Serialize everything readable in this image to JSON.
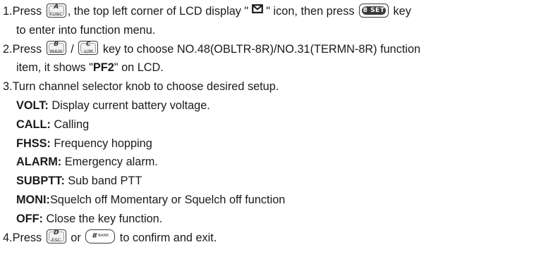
{
  "lines": {
    "l1": {
      "t1": "1.Press ",
      "t2": ", the top left corner of LCD display \" ",
      "t3": " \" icon, then press ",
      "t4": " key"
    },
    "l2": {
      "t1": "to enter into function menu."
    },
    "l3": {
      "t1": "2.Press ",
      "t2": " / ",
      "t3": " key to choose NO.48(OBLTR-8R)/NO.31(TERMN-8R) function"
    },
    "l4": {
      "t1": "item, it shows \"",
      "bold": "PF2",
      "t2": "\" on LCD."
    },
    "l5": {
      "t1": "3.Turn channel selector knob to choose desired setup."
    },
    "items": [
      {
        "term": "VOLT:",
        "desc": " Display current battery voltage."
      },
      {
        "term": "CALL:",
        "desc": " Calling"
      },
      {
        "term": "FHSS:",
        "desc": " Frequency hopping"
      },
      {
        "term": "ALARM:",
        "desc": " Emergency alarm."
      },
      {
        "term": "SUBPTT:",
        "desc": " Sub band PTT"
      },
      {
        "term": "MONI:",
        "desc": "Squelch off Momentary or Squelch off function"
      },
      {
        "term": "OFF:",
        "desc": " Close the key function."
      }
    ],
    "l6": {
      "t1": "4.Press ",
      "t2": " or ",
      "t3": " to confirm and exit."
    }
  },
  "keys": {
    "func": {
      "big": "A",
      "small": "FUNC",
      "icon": "func-key-icon"
    },
    "set": {
      "label": "8 SET",
      "icon": "set-key-icon"
    },
    "main": {
      "big": "B",
      "small": "MAIN",
      "icon": "main-key-icon"
    },
    "vm": {
      "big": "C",
      "small": "V/M",
      "icon": "vm-key-icon"
    },
    "esc": {
      "big": "D",
      "small": "ESC",
      "icon": "esc-key-icon"
    },
    "bank": {
      "big": "#",
      "small": "BANK",
      "icon": "bank-key-icon"
    }
  },
  "icons": {
    "mail": "envelope-icon"
  },
  "colors": {
    "text": "#1a1a1a",
    "key_border": "#3a3a3a"
  }
}
